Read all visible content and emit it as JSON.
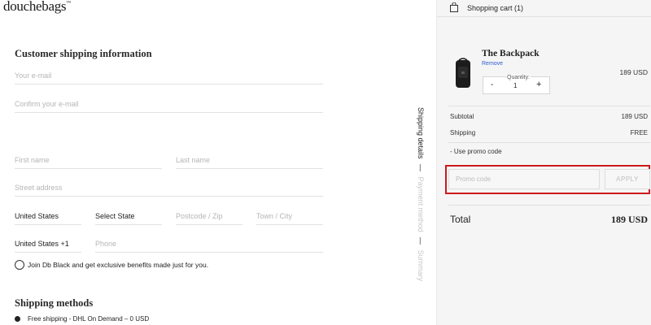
{
  "brand": {
    "logo_text": "douchebags",
    "logo_tm": "™"
  },
  "shipping_info": {
    "heading": "Customer shipping information",
    "email_placeholder": "Your e-mail",
    "confirm_email_placeholder": "Confirm your e-mail",
    "first_name_placeholder": "First name",
    "last_name_placeholder": "Last name",
    "street_placeholder": "Street address",
    "country": "United States",
    "state": "Select State",
    "postcode_placeholder": "Postcode / Zip",
    "town_placeholder": "Town / City",
    "phone_prefix": "United States +1",
    "phone_placeholder": "Phone",
    "join_label": "Join Db Black and get exclusive benefits made just for you."
  },
  "shipping_methods": {
    "heading": "Shipping methods",
    "selected_option": "Free shipping - DHL On Demand – 0 USD"
  },
  "steps": {
    "active": "Shipping details",
    "separator": "—",
    "payment": "Payment method",
    "summary": "Summary"
  },
  "cart": {
    "title": "Shopping cart (1)",
    "item": {
      "name": "The Backpack",
      "remove_label": "Remove",
      "quantity_label": "Quantity:",
      "quantity": "1",
      "minus": "-",
      "plus": "+",
      "price": "189 USD"
    },
    "subtotal_label": "Subtotal",
    "subtotal_value": "189 USD",
    "shipping_label": "Shipping",
    "shipping_value": "FREE",
    "promo_toggle": "-  Use promo code",
    "promo_placeholder": "Promo code",
    "apply_label": "APPLY",
    "total_label": "Total",
    "total_value": "189 USD"
  },
  "colors": {
    "highlight_border": "#cc1a1a",
    "link": "#2f5bd3",
    "panel_bg": "#f5f5f5"
  }
}
